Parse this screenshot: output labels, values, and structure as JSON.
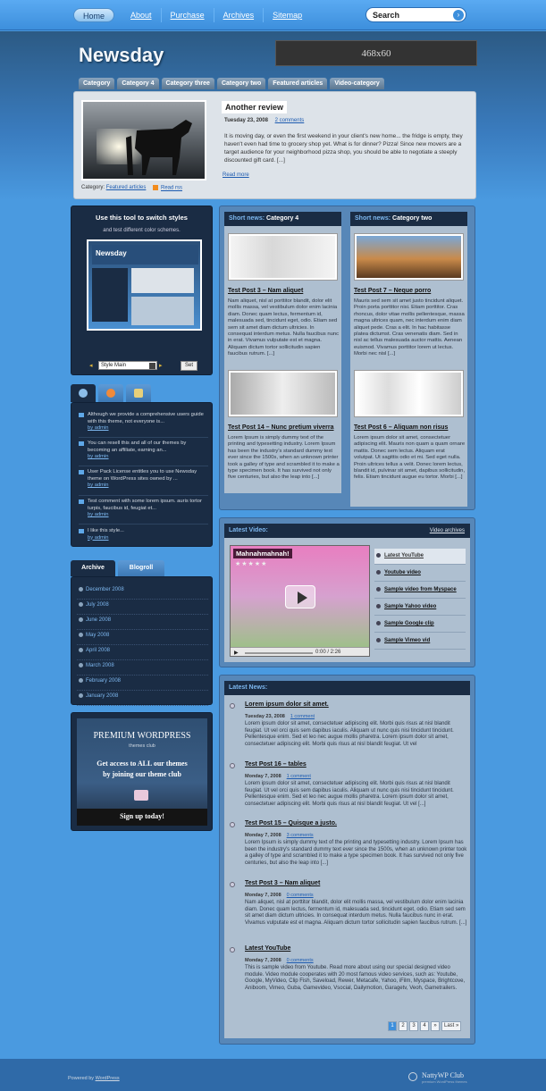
{
  "nav": {
    "items": [
      "Home",
      "About",
      "Purchase",
      "Archives",
      "Sitemap"
    ],
    "search_placeholder": "Search"
  },
  "header": {
    "logo": "Newsday",
    "ad_text": "468x60"
  },
  "categories": [
    "Category",
    "Category 4",
    "Category three",
    "Category two",
    "Featured articles",
    "Video-category"
  ],
  "featured": {
    "title": "Another review",
    "date": "Tuesday 23, 2008",
    "comments": "2 comments",
    "text": "It is moving day, or even the first weekend in your client's new home... the fridge is empty, they haven't even had time to grocery shop yet. What is for dinner? Pizza! Since new movers are a target audience for your neighborhood pizza shop, you should be able to negotiate a steeply discounted gift card. [...]",
    "more": "Read more",
    "category_label": "Category:",
    "category_link": "Featured articles",
    "rss": "Read rss"
  },
  "style_switcher": {
    "title": "Use this tool to switch styles",
    "subtitle": "and test different color schemes.",
    "thumb_logo": "Newsday",
    "selected": "Style Main",
    "button": "Set"
  },
  "comments": [
    {
      "text": "Although we provide a comprehensive users guide with this theme, not everyone is...",
      "by": "by admin"
    },
    {
      "text": "You can resell this and all of our themes by becoming an affiliate, earning an...",
      "by": "by admin"
    },
    {
      "text": "User Pack License entitles you to use Newsday theme on WordPress sites owned by ...",
      "by": "by admin"
    },
    {
      "text": "Test comment with some lorem ipsum. auris tortor turpis, faucibus id, feugiat et...",
      "by": "by admin"
    },
    {
      "text": "I like this style...",
      "by": "by admin"
    }
  ],
  "archive": {
    "tab_archive": "Archive",
    "tab_blogroll": "Blogroll",
    "months": [
      "December 2008",
      "July 2008",
      "June 2008",
      "May 2008",
      "April 2008",
      "March 2008",
      "February 2008",
      "January 2008"
    ]
  },
  "promo": {
    "line1": "PREMIUM WORDPRESS",
    "line2": "themes club",
    "line3a": "Get access to ALL our themes",
    "line3b": "by joining our theme club",
    "line4": "Sign up today!"
  },
  "short_news": {
    "label": "Short news:",
    "col1": {
      "category": "Category 4",
      "posts": [
        {
          "title": "Test Post 3 – Nam aliquet",
          "text": "Nam aliquet, nisl at porttitor blandit, dolor elit mollis massa, vel vestibulum dolor enim lacinia diam. Donec quam lectus, fermentum id, malesuada sed, tincidunt eget, odio. Etiam sed sem sit amet diam dictum ultricies. In consequat interdum metus. Nulla faucibus nunc in erat. Vivamus vulputate est et magna. Aliquam dictum tortor sollicitudin sapien faucibus rutrum. [...]"
        },
        {
          "title": "Test Post 14 – Nunc pretium viverra",
          "text": "Lorem Ipsum is simply dummy text of the printing and typesetting industry. Lorem Ipsum has been the industry's standard dummy text ever since the 1500s, when an unknown printer took a galley of type and scrambled it to make a type specimen book. It has survived not only five centuries, but also the leap into [...]"
        }
      ]
    },
    "col2": {
      "category": "Category two",
      "posts": [
        {
          "title": "Test Post 7 – Neque porro",
          "text": "Mauris sed sem sit amet justo tincidunt aliquet. Proin porta porttitor nisi. Etiam porttitor. Cras rhoncus, dolor vitae mollis pellentesque, massa magna ultrices quam, nec interdum enim diam aliquet pede. Cras a elit. In hac habitasse platea dictumst. Cras venenatis diam. Sed in nisl ac tellus malesuada auctor mattis. Aenean euismod. Vivamus porttitor lorem ut lectus. Morbi nec nisl [...]"
        },
        {
          "title": "Test Post 6 – Aliquam non risus",
          "text": "Lorem ipsum dolor sit amet, consectetuer adipiscing elit. Mauris non quam a quam ornare mattis. Donec sem lectus. Aliquam erat volutpat. Ut sagittis odio et mi. Sed eget nulla. Proin ultrices tellus a velit. Donec lorem lectus, blandit id, pulvinar sit amet, dapibus sollicitudin, felis. Etiam tincidunt augue eu tortor. Morbi [...]"
        }
      ]
    }
  },
  "video": {
    "header": "Latest Video:",
    "archives": "Video archives",
    "player_title": "Mahnahmahnah!",
    "stars": "★★★★★",
    "time": "0:00 / 2:26",
    "items": [
      "Latest YouTube",
      "Youtube video",
      "Sample video from Myspace",
      "Sample Yahoo video",
      "Sample Google clip",
      "Sample Vimeo vid"
    ]
  },
  "latest_news": {
    "header": "Latest News:",
    "items": [
      {
        "title": "Lorem ipsum dolor sit amet.",
        "date": "Tuesday 23, 2008",
        "comments": "1 comment",
        "text": "Lorem ipsum dolor sit amet, consectetuer adipiscing elit. Morbi quis risus at nisl blandit feugiat. Ut vel orci quis sem dapibus iaculis. Aliquam ut nunc quis nisi tincidunt tincidunt. Pellentesque enim. Sed et leo nec augue mollis pharetra. Lorem ipsum dolor sit amet, consectetuer adipiscing elit. Morbi quis risus at nisl blandit feugiat. Ut vel"
      },
      {
        "title": "Test Post 16 – tables",
        "date": "Monday 7, 2008",
        "comments": "1 comment",
        "text": "Lorem ipsum dolor sit amet, consectetuer adipiscing elit. Morbi quis risus at nisl blandit feugiat. Ut vel orci quis sem dapibus iaculis. Aliquam ut nunc quis nisi tincidunt tincidunt. Pellentesque enim. Sed et leo nec augue mollis pharetra. Lorem ipsum dolor sit amet, consectetuer adipiscing elit. Morbi quis risus at nisl blandit feugiat. Ut vel [...]"
      },
      {
        "title": "Test Post 15 – Quisque a justo.",
        "date": "Monday 7, 2008",
        "comments": "3 comments",
        "text": "Lorem Ipsum is simply dummy text of the printing and typesetting industry. Lorem Ipsum has been the industry's standard dummy text ever since the 1500s, when an unknown printer took a galley of type and scrambled it to make a type specimen book. It has survived not only five centuries, but also the leap into [...]"
      },
      {
        "title": "Test Post 3 – Nam aliquet",
        "date": "Monday 7, 2008",
        "comments": "0 comments",
        "text": "Nam aliquet, nisl at porttitor blandit, dolor elit mollis massa, vel vestibulum dolor enim lacinia diam. Donec quam lectus, fermentum id, malesuada sed, tincidunt eget, odio. Etiam sed sem sit amet diam dictum ultricies. In consequat interdum metus. Nulla faucibus nunc in erat. Vivamus vulputate est et magna. Aliquam dictum tortor sollicitudin sapien faucibus rutrum. [...]"
      },
      {
        "title": "Latest YouTube",
        "date": "Monday 7, 2008",
        "comments": "0 comments",
        "text": "This is sample video from Youtube. Read more about using our special designed video module. Video module cooperates with 20 most famous video services, such as: Youtube, Google, MyVideo, Clip Fish, Saveload, Rewer, Metacafe, Yahoo, iFilm, Myspace, Brightcove, Aniboom, Vimeo, Guba, Gamevideo, Vsocial, Dailymotion, Garagetv, Veoh, Gametrailers."
      }
    ]
  },
  "pager": [
    "1",
    "2",
    "3",
    "4",
    "»",
    "Last »"
  ],
  "footer": {
    "powered_prefix": "Powered by",
    "powered_link": "WordPress",
    "club_name": "NattyWP Club",
    "club_tag": "premium WordPress themes"
  },
  "colors": {
    "accent": "#3d8fdc",
    "dark_panel": "#1a2c44",
    "background": "#4a9ae0"
  }
}
